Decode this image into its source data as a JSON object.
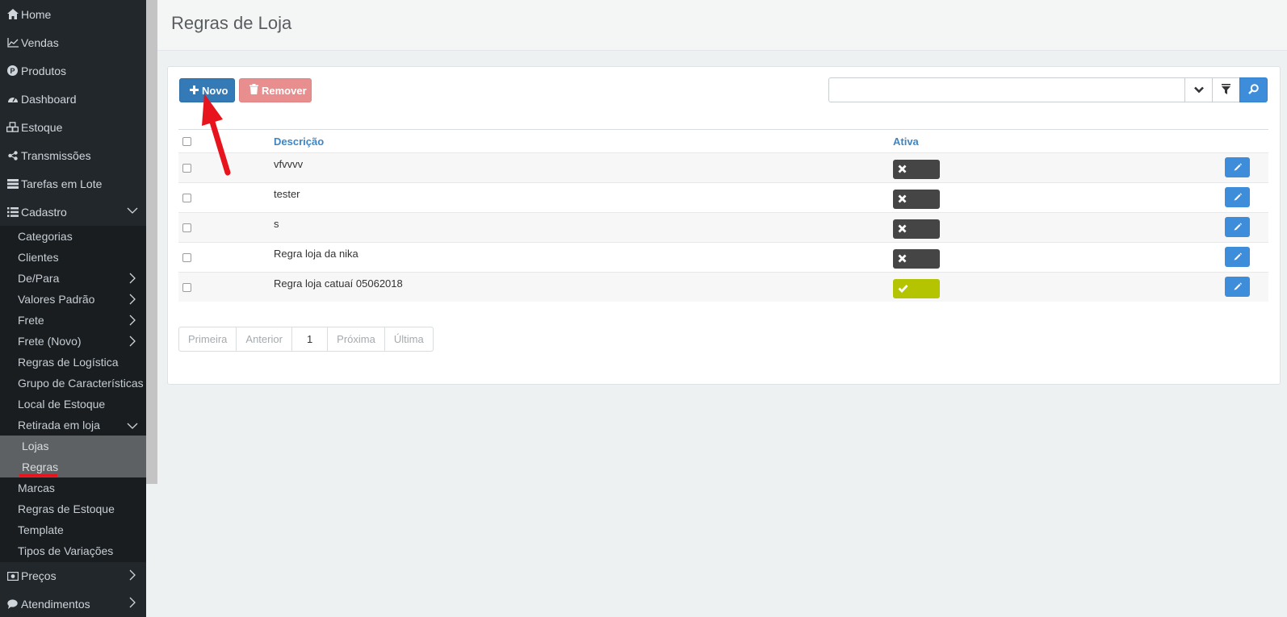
{
  "sidebar": {
    "top_items": [
      {
        "label": "Home",
        "icon": "home-icon"
      },
      {
        "label": "Vendas",
        "icon": "chart-line-icon"
      },
      {
        "label": "Produtos",
        "icon": "product-p-icon"
      },
      {
        "label": "Dashboard",
        "icon": "dashboard-icon"
      },
      {
        "label": "Estoque",
        "icon": "cubes-icon"
      },
      {
        "label": "Transmissões",
        "icon": "share-icon"
      },
      {
        "label": "Tarefas em Lote",
        "icon": "server-icon"
      },
      {
        "label": "Cadastro",
        "icon": "list-icon",
        "expanded": true
      }
    ],
    "cadastro_items": [
      {
        "label": "Categorias"
      },
      {
        "label": "Clientes"
      },
      {
        "label": "De/Para",
        "has_children": true
      },
      {
        "label": "Valores Padrão",
        "has_children": true
      },
      {
        "label": "Frete",
        "has_children": true
      },
      {
        "label": "Frete (Novo)",
        "has_children": true
      },
      {
        "label": "Regras de Logística"
      },
      {
        "label": "Grupo de Características"
      },
      {
        "label": "Local de Estoque"
      },
      {
        "label": "Retirada em loja",
        "expanded": true
      }
    ],
    "retirada_items": [
      {
        "label": "Lojas"
      },
      {
        "label": "Regras",
        "active": true
      }
    ],
    "cadastro_items_after": [
      {
        "label": "Marcas"
      },
      {
        "label": "Regras de Estoque"
      },
      {
        "label": "Template"
      },
      {
        "label": "Tipos de Variações"
      }
    ],
    "bottom_items": [
      {
        "label": "Preços",
        "icon": "money-icon"
      },
      {
        "label": "Atendimentos",
        "icon": "chat-icon"
      }
    ]
  },
  "header": {
    "title": "Regras de Loja"
  },
  "toolbar": {
    "new_label": "Novo",
    "remove_label": "Remover",
    "search_value": ""
  },
  "table": {
    "columns": [
      "Descrição",
      "Ativa"
    ],
    "rows": [
      {
        "description": "vfvvvv",
        "active": false
      },
      {
        "description": "tester",
        "active": false
      },
      {
        "description": "s",
        "active": false
      },
      {
        "description": "Regra loja da nika",
        "active": false
      },
      {
        "description": "Regra loja catuaí 05062018",
        "active": true
      }
    ]
  },
  "pagination": {
    "first": "Primeira",
    "previous": "Anterior",
    "current": "1",
    "next": "Próxima",
    "last": "Última"
  },
  "colors": {
    "sidebar_bg": "#22272c",
    "primary": "#337ab7",
    "danger_muted": "#e88e8f",
    "toggle_on": "#b4c400",
    "toggle_off": "#454545",
    "link_blue": "#3d86c6",
    "annotation_red": "#e8141d"
  }
}
